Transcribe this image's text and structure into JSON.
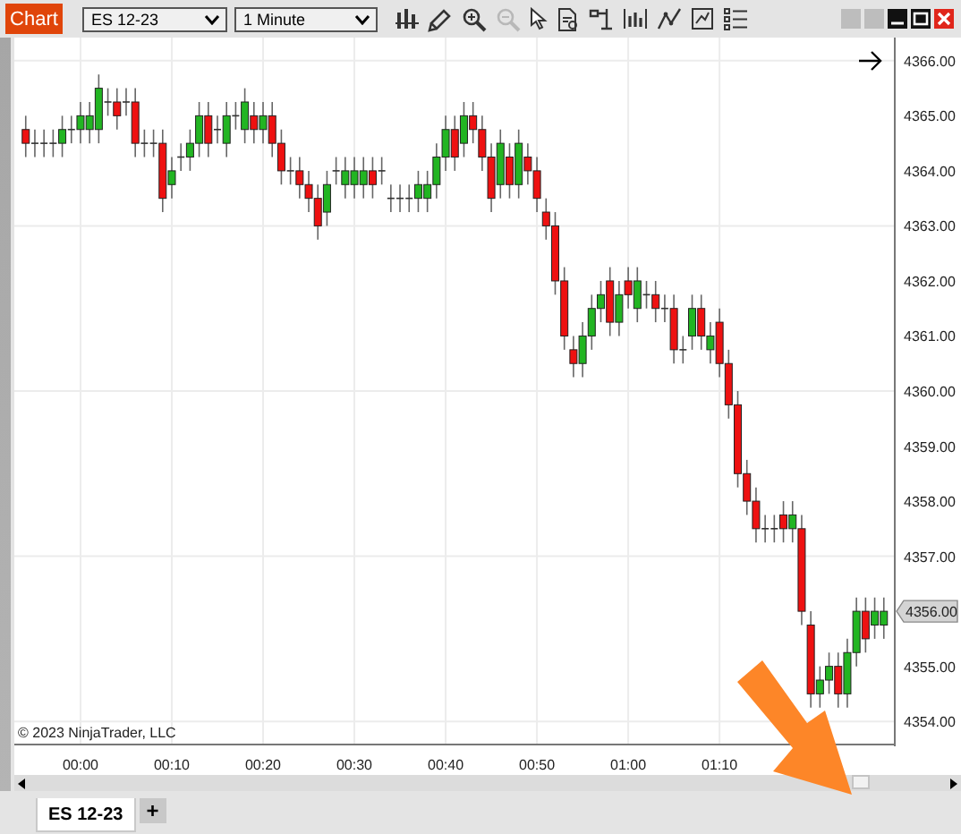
{
  "toolbar": {
    "title_button": "Chart",
    "instrument": "ES 12-23",
    "interval": "1 Minute",
    "tools": [
      {
        "disabled": false
      },
      {
        "disabled": false
      },
      {
        "disabled": false
      },
      {
        "disabled": true
      },
      {
        "disabled": false
      },
      {
        "disabled": false
      },
      {
        "disabled": false
      },
      {
        "disabled": false
      },
      {
        "disabled": false
      },
      {
        "disabled": false
      },
      {
        "disabled": false
      }
    ]
  },
  "chart": {
    "copyright": "© 2023 NinjaTrader, LLC",
    "price_marker": "4356.00",
    "chart_data": {
      "type": "candlestick",
      "grid": true,
      "xlim": [
        -7.25,
        89.2
      ],
      "ylim": [
        4353.58,
        4366.42
      ],
      "x": [
        -6,
        -5,
        -4,
        -3,
        -2,
        -1,
        0,
        1,
        2,
        3,
        4,
        5,
        6,
        7,
        8,
        9,
        10,
        11,
        12,
        13,
        14,
        15,
        16,
        17,
        18,
        19,
        20,
        21,
        22,
        23,
        24,
        25,
        26,
        27,
        28,
        29,
        30,
        31,
        32,
        33,
        34,
        35,
        36,
        37,
        38,
        39,
        40,
        41,
        42,
        43,
        44,
        45,
        46,
        47,
        48,
        49,
        50,
        51,
        52,
        53,
        54,
        55,
        56,
        57,
        58,
        59,
        60,
        61,
        62,
        63,
        64,
        65,
        66,
        67,
        68,
        69,
        70,
        71,
        72,
        73,
        74,
        75,
        76,
        77,
        78,
        79,
        80,
        81,
        82,
        83,
        84,
        85,
        86,
        87,
        88
      ],
      "ohlc": [
        [
          4364.75,
          4365,
          4364.25,
          4364.5
        ],
        [
          4364.5,
          4364.75,
          4364.25,
          4364.5
        ],
        [
          4364.5,
          4364.75,
          4364.25,
          4364.5
        ],
        [
          4364.5,
          4364.75,
          4364.25,
          4364.5
        ],
        [
          4364.5,
          4365,
          4364.25,
          4364.75
        ],
        [
          4364.75,
          4365,
          4364.5,
          4364.75
        ],
        [
          4364.75,
          4365.25,
          4364.5,
          4365
        ],
        [
          4364.75,
          4365.25,
          4364.5,
          4365
        ],
        [
          4364.75,
          4365.75,
          4364.5,
          4365.5
        ],
        [
          4365.25,
          4365.5,
          4365,
          4365.25
        ],
        [
          4365.25,
          4365.5,
          4364.75,
          4365
        ],
        [
          4365.25,
          4365.5,
          4365,
          4365.25
        ],
        [
          4365.25,
          4365.5,
          4364.25,
          4364.5
        ],
        [
          4364.5,
          4364.75,
          4364.25,
          4364.5
        ],
        [
          4364.5,
          4364.75,
          4364.25,
          4364.5
        ],
        [
          4364.5,
          4364.75,
          4363.25,
          4363.5
        ],
        [
          4363.75,
          4364.25,
          4363.5,
          4364
        ],
        [
          4364.25,
          4364.5,
          4364,
          4364.25
        ],
        [
          4364.25,
          4364.75,
          4364,
          4364.5
        ],
        [
          4364.5,
          4365.25,
          4364.25,
          4365
        ],
        [
          4365,
          4365.25,
          4364.25,
          4364.5
        ],
        [
          4364.75,
          4365,
          4364.5,
          4364.75
        ],
        [
          4364.5,
          4365.25,
          4364.25,
          4365
        ],
        [
          4365,
          4365.25,
          4364.75,
          4365
        ],
        [
          4364.75,
          4365.5,
          4364.5,
          4365.25
        ],
        [
          4365,
          4365.25,
          4364.5,
          4364.75
        ],
        [
          4364.75,
          4365.25,
          4364.5,
          4365
        ],
        [
          4365,
          4365.25,
          4364.25,
          4364.5
        ],
        [
          4364.5,
          4364.75,
          4363.75,
          4364
        ],
        [
          4364,
          4364.25,
          4363.75,
          4364
        ],
        [
          4364,
          4364.25,
          4363.5,
          4363.75
        ],
        [
          4363.75,
          4364,
          4363.25,
          4363.5
        ],
        [
          4363.5,
          4363.75,
          4362.75,
          4363
        ],
        [
          4363.25,
          4364,
          4363,
          4363.75
        ],
        [
          4364,
          4364.25,
          4363.75,
          4364
        ],
        [
          4363.75,
          4364.25,
          4363.5,
          4364
        ],
        [
          4363.75,
          4364.25,
          4363.5,
          4364
        ],
        [
          4363.75,
          4364.25,
          4363.5,
          4364
        ],
        [
          4364,
          4364.25,
          4363.5,
          4363.75
        ],
        [
          4364,
          4364.25,
          4363.75,
          4364
        ],
        [
          4363.5,
          4363.75,
          4363.25,
          4363.5
        ],
        [
          4363.5,
          4363.75,
          4363.25,
          4363.5
        ],
        [
          4363.5,
          4363.75,
          4363.25,
          4363.5
        ],
        [
          4363.5,
          4364,
          4363.25,
          4363.75
        ],
        [
          4363.5,
          4364,
          4363.25,
          4363.75
        ],
        [
          4363.75,
          4364.5,
          4363.5,
          4364.25
        ],
        [
          4364.25,
          4365,
          4364,
          4364.75
        ],
        [
          4364.75,
          4365,
          4364,
          4364.25
        ],
        [
          4364.5,
          4365.25,
          4364.25,
          4365
        ],
        [
          4365,
          4365.25,
          4364.5,
          4364.75
        ],
        [
          4364.75,
          4365,
          4364,
          4364.25
        ],
        [
          4364.25,
          4364.5,
          4363.25,
          4363.5
        ],
        [
          4363.75,
          4364.75,
          4363.5,
          4364.5
        ],
        [
          4364.25,
          4364.5,
          4363.5,
          4363.75
        ],
        [
          4363.75,
          4364.75,
          4363.5,
          4364.5
        ],
        [
          4364.25,
          4364.5,
          4363.75,
          4364
        ],
        [
          4364,
          4364.25,
          4363.25,
          4363.5
        ],
        [
          4363.25,
          4363.5,
          4362.75,
          4363
        ],
        [
          4363,
          4363.25,
          4361.75,
          4362
        ],
        [
          4362,
          4362.25,
          4360.75,
          4361
        ],
        [
          4360.75,
          4361,
          4360.25,
          4360.5
        ],
        [
          4360.5,
          4361.25,
          4360.25,
          4361
        ],
        [
          4361,
          4361.75,
          4360.75,
          4361.5
        ],
        [
          4361.5,
          4362,
          4361.25,
          4361.75
        ],
        [
          4362,
          4362.25,
          4361,
          4361.25
        ],
        [
          4361.25,
          4362,
          4361,
          4361.75
        ],
        [
          4362,
          4362.25,
          4361.5,
          4361.75
        ],
        [
          4361.5,
          4362.25,
          4361.25,
          4362
        ],
        [
          4361.75,
          4362,
          4361.5,
          4361.75
        ],
        [
          4361.75,
          4362,
          4361.25,
          4361.5
        ],
        [
          4361.5,
          4361.75,
          4361.25,
          4361.5
        ],
        [
          4361.5,
          4361.75,
          4360.5,
          4360.75
        ],
        [
          4360.75,
          4361,
          4360.5,
          4360.75
        ],
        [
          4361,
          4361.75,
          4360.75,
          4361.5
        ],
        [
          4361.5,
          4361.75,
          4360.75,
          4361
        ],
        [
          4360.75,
          4361.25,
          4360.5,
          4361
        ],
        [
          4361.25,
          4361.5,
          4360.25,
          4360.5
        ],
        [
          4360.5,
          4360.75,
          4359.5,
          4359.75
        ],
        [
          4359.75,
          4360,
          4358.25,
          4358.5
        ],
        [
          4358.5,
          4358.75,
          4357.75,
          4358
        ],
        [
          4358,
          4358.25,
          4357.25,
          4357.5
        ],
        [
          4357.5,
          4357.75,
          4357.25,
          4357.5
        ],
        [
          4357.5,
          4357.75,
          4357.25,
          4357.5
        ],
        [
          4357.75,
          4358,
          4357.25,
          4357.5
        ],
        [
          4357.5,
          4358,
          4357.25,
          4357.75
        ],
        [
          4357.5,
          4357.75,
          4355.75,
          4356
        ],
        [
          4355.75,
          4356,
          4354.25,
          4354.5
        ],
        [
          4354.5,
          4355,
          4354.25,
          4354.75
        ],
        [
          4354.75,
          4355.25,
          4354.5,
          4355
        ],
        [
          4355,
          4355.25,
          4354.25,
          4354.5
        ],
        [
          4354.5,
          4355.5,
          4354.25,
          4355.25
        ],
        [
          4355.25,
          4356.25,
          4355,
          4356
        ],
        [
          4356,
          4356.25,
          4355.25,
          4355.5
        ],
        [
          4355.75,
          4356.25,
          4355.5,
          4356
        ],
        [
          4355.75,
          4356.25,
          4355.5,
          4356
        ]
      ],
      "xticks": [
        {
          "value": 0,
          "label": "00:00"
        },
        {
          "value": 10,
          "label": "00:10"
        },
        {
          "value": 20,
          "label": "00:20"
        },
        {
          "value": 30,
          "label": "00:30"
        },
        {
          "value": 40,
          "label": "00:40"
        },
        {
          "value": 50,
          "label": "00:50"
        },
        {
          "value": 60,
          "label": "01:00"
        },
        {
          "value": 70,
          "label": "01:10"
        }
      ],
      "yticks": [
        {
          "value": 4354,
          "label": "4354.00"
        },
        {
          "value": 4355,
          "label": "4355.00"
        },
        {
          "value": 4356,
          "label": "4356.00"
        },
        {
          "value": 4357,
          "label": "4357.00"
        },
        {
          "value": 4358,
          "label": "4358.00"
        },
        {
          "value": 4359,
          "label": "4359.00"
        },
        {
          "value": 4360,
          "label": "4360.00"
        },
        {
          "value": 4361,
          "label": "4361.00"
        },
        {
          "value": 4362,
          "label": "4362.00"
        },
        {
          "value": 4363,
          "label": "4363.00"
        },
        {
          "value": 4364,
          "label": "4364.00"
        },
        {
          "value": 4365,
          "label": "4365.00"
        },
        {
          "value": 4366,
          "label": "4366.00"
        }
      ]
    }
  },
  "tabs": [
    {
      "label": "ES 12-23",
      "selected": true
    }
  ],
  "add_tab": "+"
}
